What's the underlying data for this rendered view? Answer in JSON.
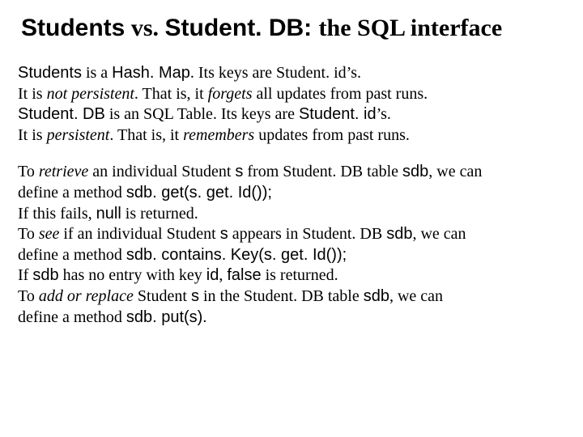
{
  "title": {
    "t1": "Students",
    "t2": " vs. ",
    "t3": "Student. DB: ",
    "t4": "the SQL interface"
  },
  "lines": {
    "l1a": "Students",
    "l1b": " is a ",
    "l1c": "Hash. Map",
    "l1d": ".   Its keys are Student. id’s.",
    "l2a": "It is ",
    "l2b": "not persistent",
    "l2c": ".  That is, it ",
    "l2d": "forgets",
    "l2e": " all updates from past runs.",
    "l3a": "Student. DB",
    "l3b": " is an SQL Table.  Its keys are ",
    "l3c": "Student. id",
    "l3d": "’s.",
    "l4a": "It is ",
    "l4b": "persistent",
    "l4c": ".  That is, it ",
    "l4d": "remembers",
    "l4e": " updates from past runs.",
    "l5a": "To ",
    "l5b": "retrieve",
    "l5c": " an individual Student ",
    "l5d": "s",
    "l5e": " from Student. DB table ",
    "l5f": "sdb",
    "l5g": ", we can",
    "l6a": "define a method ",
    "l6b": "sdb. get(s. get. Id());",
    "l7a": "If this fails, ",
    "l7b": "null",
    "l7c": " is returned.",
    "l8a": "To ",
    "l8b": "see",
    "l8c": " if an individual Student ",
    "l8d": "s",
    "l8e": " appears in Student. DB ",
    "l8f": "sdb",
    "l8g": ", we can",
    "l9a": "define a method ",
    "l9b": "sdb. contains. Key(s. get. Id());",
    "l10a": "If ",
    "l10b": "sdb",
    "l10c": " has no entry with key ",
    "l10d": "id",
    "l10e": ", ",
    "l10f": "false",
    "l10g": " is returned.",
    "l11a": "To ",
    "l11b": "add or replace",
    "l11c": " Student ",
    "l11d": "s",
    "l11e": " in the Student. DB table ",
    "l11f": "sdb",
    "l11g": ", we can",
    "l12a": "define a method ",
    "l12b": "sdb. put(s)",
    "l12c": "."
  }
}
